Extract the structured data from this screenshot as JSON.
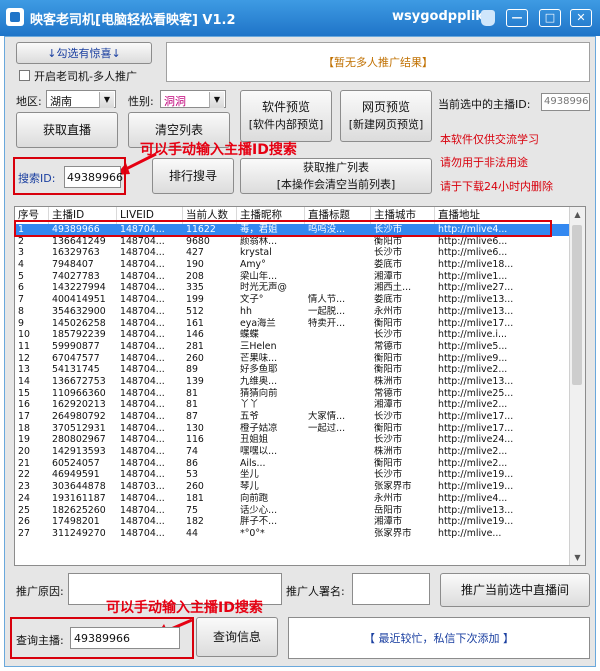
{
  "titlebar": {
    "title": "映客老司机[电脑轻松看映客] V1.2",
    "user": "wsygodpplike",
    "minimize": "—",
    "restore": "□",
    "close": "✕"
  },
  "top": {
    "surprise_button": "↓勾选有惊喜↓",
    "multi_checkbox_label": "开启老司机-多人推广",
    "promo_result": "【暂无多人推广结果】"
  },
  "filters": {
    "region_label": "地区:",
    "region_value": "湖南",
    "gender_label": "性别:",
    "gender_value": "洞洞"
  },
  "buttons": {
    "get_live": "获取直播",
    "clear_list": "清空列表",
    "software_preview_1": "软件预览",
    "software_preview_2": "[软件内部预览]",
    "web_preview_1": "网页预览",
    "web_preview_2": "[新建网页预览]",
    "rank_search": "排行搜寻",
    "get_rank_1": "获取推广列表",
    "get_rank_2": "[本操作会清空当前列表]",
    "promote_selected": "推广当前选中直播间",
    "query_info": "查询信息"
  },
  "selected_host": {
    "label": "当前选中的主播ID:",
    "value": "49389966"
  },
  "notices": {
    "line1": "本软件仅供交流学习",
    "line2": "请勿用于非法用途",
    "line3": "请于下载24小时内删除"
  },
  "search": {
    "label": "搜索ID:",
    "value": "49389966"
  },
  "annotations": {
    "top": "可以手动输入主播ID搜索",
    "bottom": "可以手动输入主播ID搜索"
  },
  "table": {
    "columns": [
      "序号",
      "主播ID",
      "LIVEID",
      "当前人数",
      "主播昵称",
      "直播标题",
      "主播城市",
      "直播地址"
    ],
    "rows": [
      [
        "1",
        "49389966",
        "148704...",
        "11622",
        "毒，君姐",
        "呜呜没...",
        "长沙市",
        "http://mlive4..."
      ],
      [
        "2",
        "136641249",
        "148704...",
        "9680",
        "颜翁林...",
        "",
        "衡阳市",
        "http://mlive6..."
      ],
      [
        "3",
        "16329763",
        "148704...",
        "427",
        "krystal",
        "",
        "长沙市",
        "http://mlive6..."
      ],
      [
        "4",
        "7948407",
        "148704...",
        "190",
        "Amy°",
        "",
        "娄底市",
        "http://mlive18..."
      ],
      [
        "5",
        "74027783",
        "148704...",
        "208",
        "梁山年...",
        "",
        "湘潭市",
        "http://mlive1..."
      ],
      [
        "6",
        "143227994",
        "148704...",
        "335",
        "时光无声@",
        "",
        "湘西土...",
        "http://mlive27..."
      ],
      [
        "7",
        "400414951",
        "148704...",
        "199",
        "文子°",
        "情人节...",
        "娄底市",
        "http://mlive13..."
      ],
      [
        "8",
        "354632900",
        "148704...",
        "512",
        "hh",
        "一起脱...",
        "永州市",
        "http://mlive13..."
      ],
      [
        "9",
        "145026258",
        "148704...",
        "161",
        "eya海兰",
        "特卖开...",
        "衡阳市",
        "http://mlive17..."
      ],
      [
        "10",
        "185792239",
        "148704...",
        "146",
        "蝶蝶",
        "",
        "长沙市",
        "http://mlive.i..."
      ],
      [
        "11",
        "59990877",
        "148704...",
        "281",
        "三Helen",
        "",
        "常德市",
        "http://mlive5..."
      ],
      [
        "12",
        "67047577",
        "148704...",
        "260",
        "芒果味...",
        "",
        "衡阳市",
        "http://mlive9..."
      ],
      [
        "13",
        "54131745",
        "148704...",
        "89",
        "好多鱼耶",
        "",
        "衡阳市",
        "http://mlive2..."
      ],
      [
        "14",
        "136672753",
        "148704...",
        "139",
        "九维奥...",
        "",
        "株洲市",
        "http://mlive13..."
      ],
      [
        "15",
        "110966360",
        "148704...",
        "81",
        "猜猜向前",
        "",
        "常德市",
        "http://mlive25..."
      ],
      [
        "16",
        "162920213",
        "148704...",
        "81",
        "丫丫",
        "",
        "湘潭市",
        "http://mlive2..."
      ],
      [
        "17",
        "264980792",
        "148704...",
        "87",
        "五爷",
        "大家情...",
        "长沙市",
        "http://mlive17..."
      ],
      [
        "18",
        "370512931",
        "148704...",
        "130",
        "橙子姑凉",
        "一起过...",
        "衡阳市",
        "http://mlive17..."
      ],
      [
        "19",
        "280802967",
        "148704...",
        "116",
        "丑姐姐",
        "",
        "长沙市",
        "http://mlive24..."
      ],
      [
        "20",
        "142913593",
        "148704...",
        "74",
        "嘿嘿以...",
        "",
        "株洲市",
        "http://mlive2..."
      ],
      [
        "21",
        "60524057",
        "148704...",
        "86",
        "Ails...",
        "",
        "衡阳市",
        "http://mlive2..."
      ],
      [
        "22",
        "46949591",
        "148704...",
        "53",
        "坐儿",
        "",
        "长沙市",
        "http://mlive19..."
      ],
      [
        "23",
        "303644878",
        "148703...",
        "260",
        "琴儿",
        "",
        "张家界市",
        "http://mlive19..."
      ],
      [
        "24",
        "193161187",
        "148704...",
        "181",
        "向前跑",
        "",
        "永州市",
        "http://mlive4..."
      ],
      [
        "25",
        "182625260",
        "148704...",
        "75",
        "话少心...",
        "",
        "岳阳市",
        "http://mlive13..."
      ],
      [
        "26",
        "17498201",
        "148704...",
        "182",
        "胖子不...",
        "",
        "湘潭市",
        "http://mlive19..."
      ],
      [
        "27",
        "311249270",
        "148704...",
        "44",
        "*°0°*",
        "",
        "张家界市",
        "http://mlive..."
      ]
    ]
  },
  "bottom": {
    "reason_label": "推广原因:",
    "signature_label": "推广人署名:",
    "query_label": "查询主播:",
    "query_value": "49389966",
    "status": "【 最近较忙，私信下次添加 】"
  },
  "colors": {
    "titlebar": "#1f74c8",
    "selected_row": "#3388f0",
    "highlight_red": "#d8000c",
    "status_blue": "#1a3fa0"
  }
}
